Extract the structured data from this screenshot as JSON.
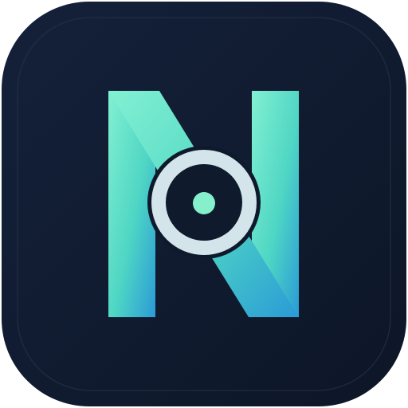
{
  "icon": {
    "semantic": "app-icon",
    "mark": "N",
    "colors": {
      "background_top": "#14213a",
      "background_bottom": "#0d1627",
      "inner_border": "#26334a",
      "letter_gradient_start": "#82f0d2",
      "letter_gradient_mid": "#4fd6c4",
      "letter_gradient_end": "#2a9bd6",
      "ring_outer": "#0e1a2b",
      "ring": "#d3e4ea",
      "lens": "#0f1b2c",
      "dot": "#86f0cc"
    }
  }
}
